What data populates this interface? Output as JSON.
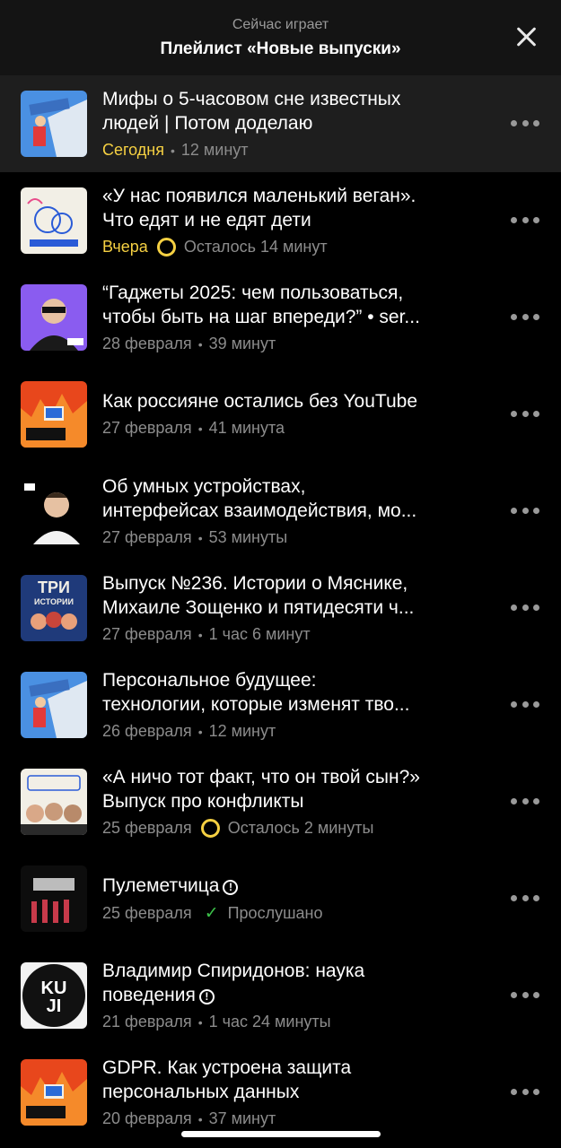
{
  "header": {
    "subtitle": "Сейчас играет",
    "title": "Плейлист «Новые выпуски»"
  },
  "colors": {
    "accent": "#f5d042",
    "background": "#000000",
    "active_row": "#1e1e1e",
    "listened": "#3cc24a"
  },
  "items": [
    {
      "title": "Мифы о 5-часовом сне известных людей | Потом доделаю",
      "lines": [
        "Мифы о 5-часовом сне известных",
        "людей | Потом доделаю"
      ],
      "date": "Сегодня",
      "status": "12 минут",
      "cover": "potom-dodelayu"
    },
    {
      "title": "«У нас появился маленький веган». Что едят и не едят дети",
      "lines": [
        "«У нас появился маленький веган».",
        "Что едят и не едят дети"
      ],
      "date": "Вчера",
      "status": "Осталось 14 минут",
      "cover": "sperva-rodi"
    },
    {
      "title": "“Гаджеты 2025: чем пользоваться, чтобы быть на шаг впереди?” • ser...",
      "lines": [
        "“Гаджеты 2025: чем пользоваться,",
        "чтобы быть на шаг впереди?” • ser..."
      ],
      "date": "28 февраля",
      "status": "39 минут",
      "cover": "gadgets"
    },
    {
      "title": "Как россияне остались без YouTube",
      "lines": [
        "Как россияне остались без YouTube"
      ],
      "date": "27 февраля",
      "status": "41 минута",
      "cover": "zapusk-zavtra"
    },
    {
      "title": "Об умных устройствах, интерфейсах взаимодействия, мо...",
      "lines": [
        "Об умных устройствах,",
        "интерфейсах взаимодействия, мо..."
      ],
      "date": "27 февраля",
      "status": "53 минуты",
      "cover": "make-sense"
    },
    {
      "title": "Выпуск №236. Истории о Мяснике, Михаиле Зощенко и пятидесяти ч...",
      "lines": [
        "Выпуск №236. Истории о Мяснике,",
        "Михаиле Зощенко и пятидесяти ч..."
      ],
      "date": "27 февраля",
      "status": "1 час 6 минут",
      "cover": "tri-istorii",
      "cover_text": [
        "ТРИ",
        "ИСТОРИИ"
      ]
    },
    {
      "title": "Персональное будущее: технологии, которые изменят тво...",
      "lines": [
        "Персональное будущее:",
        "технологии, которые изменят тво..."
      ],
      "date": "26 февраля",
      "status": "12 минут",
      "cover": "potom-dodelayu"
    },
    {
      "title": "«А ничо тот факт, что он твой сын?» Выпуск про конфликты",
      "lines": [
        "«А ничо тот факт, что он твой сын?»",
        "Выпуск про конфликты"
      ],
      "date": "25 февраля",
      "status": "Осталось 2 минуты",
      "cover": "konflikty"
    },
    {
      "title": "Пулеметчица",
      "lines": [
        "Пулеметчица"
      ],
      "date": "25 февраля",
      "status": "Прослушано",
      "cover": "dark"
    },
    {
      "title": "Владимир Спиридонов: наука поведения",
      "lines": [
        "Владимир Спиридонов: наука",
        "поведения"
      ],
      "date": "21 февраля",
      "status": "1 час 24 минуты",
      "cover": "kuji",
      "cover_text": [
        "KU",
        "JI"
      ]
    },
    {
      "title": "GDPR. Как устроена защита персональных данных",
      "lines": [
        "GDPR. Как устроена защита",
        "персональных данных"
      ],
      "date": "20 февраля",
      "status": "37 минут",
      "cover": "zapusk-zavtra"
    }
  ]
}
